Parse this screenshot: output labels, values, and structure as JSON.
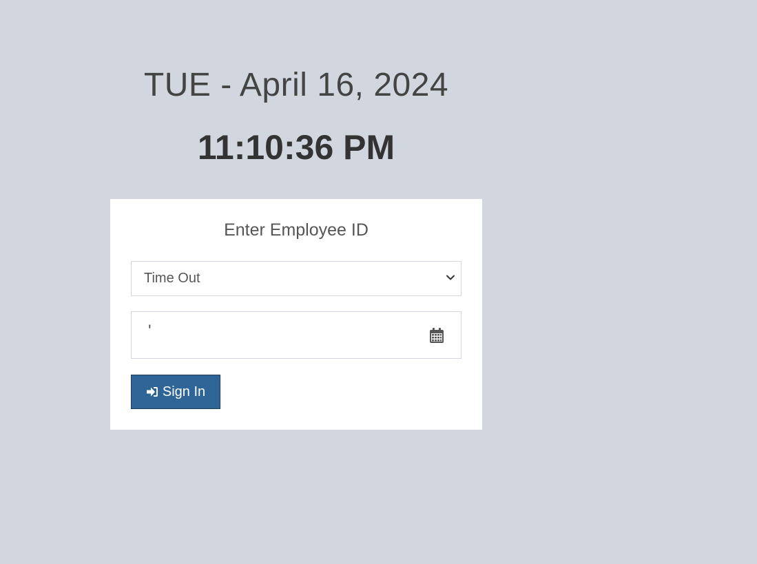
{
  "clock": {
    "date": "TUE - April 16, 2024",
    "time": "11:10:36 PM"
  },
  "login": {
    "title": "Enter Employee ID",
    "action_select": {
      "selected": "Time Out"
    },
    "employee_id_input": {
      "value": "'"
    },
    "calendar_icon": "calendar-icon",
    "submit": {
      "icon": "sign-in-icon",
      "label": "Sign In"
    }
  },
  "colors": {
    "background": "#d2d6de",
    "box": "#ffffff",
    "button": "#2e6496",
    "text": "#333333"
  }
}
